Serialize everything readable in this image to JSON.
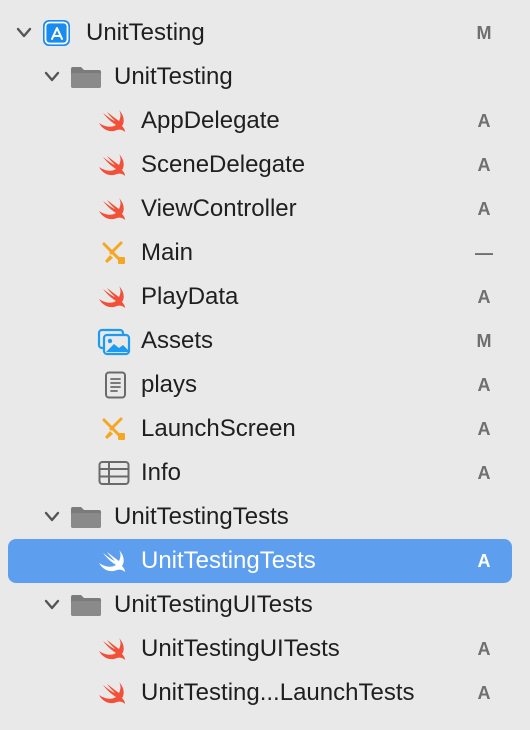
{
  "tree": {
    "project": {
      "label": "UnitTesting",
      "status": "M",
      "icon": "app-project-icon",
      "accent_color": "#1a8cf0"
    },
    "folders": [
      {
        "label": "UnitTesting",
        "icon": "folder-icon",
        "files": [
          {
            "label": "AppDelegate",
            "icon": "swift-icon",
            "status": "A"
          },
          {
            "label": "SceneDelegate",
            "icon": "swift-icon",
            "status": "A"
          },
          {
            "label": "ViewController",
            "icon": "swift-icon",
            "status": "A"
          },
          {
            "label": "Main",
            "icon": "storyboard-icon",
            "status": "—"
          },
          {
            "label": "PlayData",
            "icon": "swift-icon",
            "status": "A"
          },
          {
            "label": "Assets",
            "icon": "asset-catalog-icon",
            "status": "M"
          },
          {
            "label": "plays",
            "icon": "document-icon",
            "status": "A"
          },
          {
            "label": "LaunchScreen",
            "icon": "storyboard-icon",
            "status": "A"
          },
          {
            "label": "Info",
            "icon": "plist-table-icon",
            "status": "A"
          }
        ]
      },
      {
        "label": "UnitTestingTests",
        "icon": "folder-icon",
        "files": [
          {
            "label": "UnitTestingTests",
            "icon": "swift-icon",
            "status": "A",
            "selected": true
          }
        ]
      },
      {
        "label": "UnitTestingUITests",
        "icon": "folder-icon",
        "files": [
          {
            "label": "UnitTestingUITests",
            "icon": "swift-icon",
            "status": "A"
          },
          {
            "label": "UnitTesting...LaunchTests",
            "icon": "swift-icon",
            "status": "A"
          }
        ]
      }
    ]
  },
  "colors": {
    "background": "#e9e9e9",
    "selection": "#5e9eef",
    "swift": "#f05138",
    "storyboard": "#f5a623",
    "folder": "#7b7b7b",
    "badge": "#6f6f6f"
  }
}
